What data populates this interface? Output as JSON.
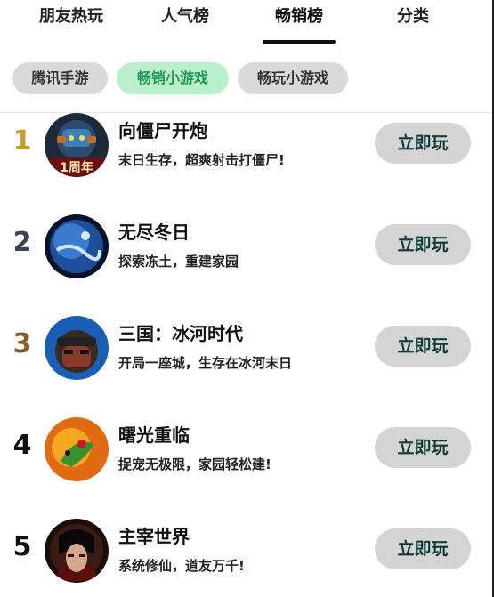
{
  "tabs": [
    {
      "label": "朋友热玩"
    },
    {
      "label": "人气榜"
    },
    {
      "label": "畅销榜"
    },
    {
      "label": "分类"
    }
  ],
  "active_tab": "畅销榜",
  "filters": [
    {
      "label": "腾讯手游"
    },
    {
      "label": "畅销小游戏"
    },
    {
      "label": "畅玩小游戏"
    }
  ],
  "active_filter": "畅销小游戏",
  "games": [
    {
      "rank": "1",
      "title": "向僵尸开炮",
      "desc": "末日生存，超爽射击打僵尸!",
      "badge": "1周年",
      "button": "立即玩",
      "rank_color": "#c99a2e",
      "icon": "zombie-cannon-icon"
    },
    {
      "rank": "2",
      "title": "无尽冬日",
      "desc": "探索冻土，重建家园",
      "button": "立即玩",
      "rank_color": "#3b4452",
      "icon": "frozen-planet-icon"
    },
    {
      "rank": "3",
      "title": "三国：冰河时代",
      "desc": "开局一座城，生存在冰河末日",
      "button": "立即玩",
      "rank_color": "#8a5a2b",
      "icon": "warrior-portrait-icon"
    },
    {
      "rank": "4",
      "title": "曙光重临",
      "desc": "捉宠无极限，家园轻松建!",
      "button": "立即玩",
      "rank_color": "#111111",
      "icon": "pet-creature-icon"
    },
    {
      "rank": "5",
      "title": "主宰世界",
      "desc": "系统修仙，道友万千!",
      "button": "立即玩",
      "rank_color": "#111111",
      "icon": "cultivator-portrait-icon"
    }
  ],
  "colors": {
    "accent_green": "#1f9a56",
    "chip_active_bg": "#b9efcc",
    "chip_bg": "#d9d9d9",
    "button_bg": "#d4d4d4",
    "button_text": "#0f3a36"
  }
}
